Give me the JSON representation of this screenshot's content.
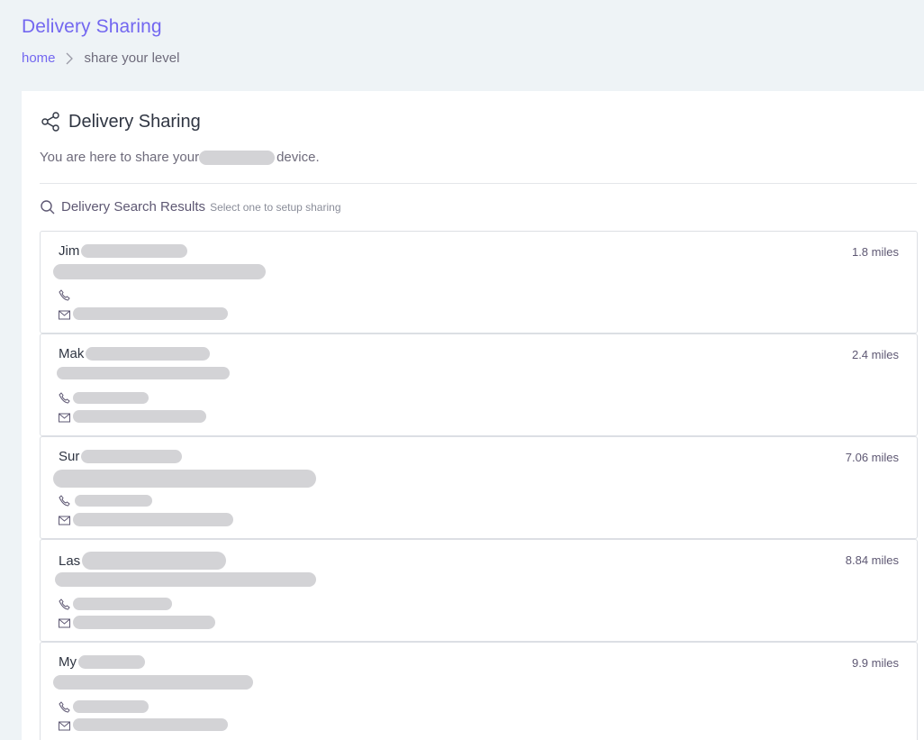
{
  "header": {
    "title": "Delivery Sharing",
    "breadcrumb": {
      "home": "home",
      "current": "share your level"
    }
  },
  "card": {
    "title": "Delivery Sharing",
    "desc_before": "You are here to share your",
    "desc_after": "device.",
    "results_title": "Delivery Search Results",
    "results_subtitle": "Select one to setup sharing"
  },
  "results": [
    {
      "name": "Jim",
      "distance": "1.8 miles"
    },
    {
      "name": "Mak",
      "distance": "2.4 miles"
    },
    {
      "name": "Sur",
      "distance": "7.06 miles"
    },
    {
      "name": "Las",
      "distance": "8.84 miles"
    },
    {
      "name": "My",
      "distance": "9.9 miles"
    }
  ]
}
